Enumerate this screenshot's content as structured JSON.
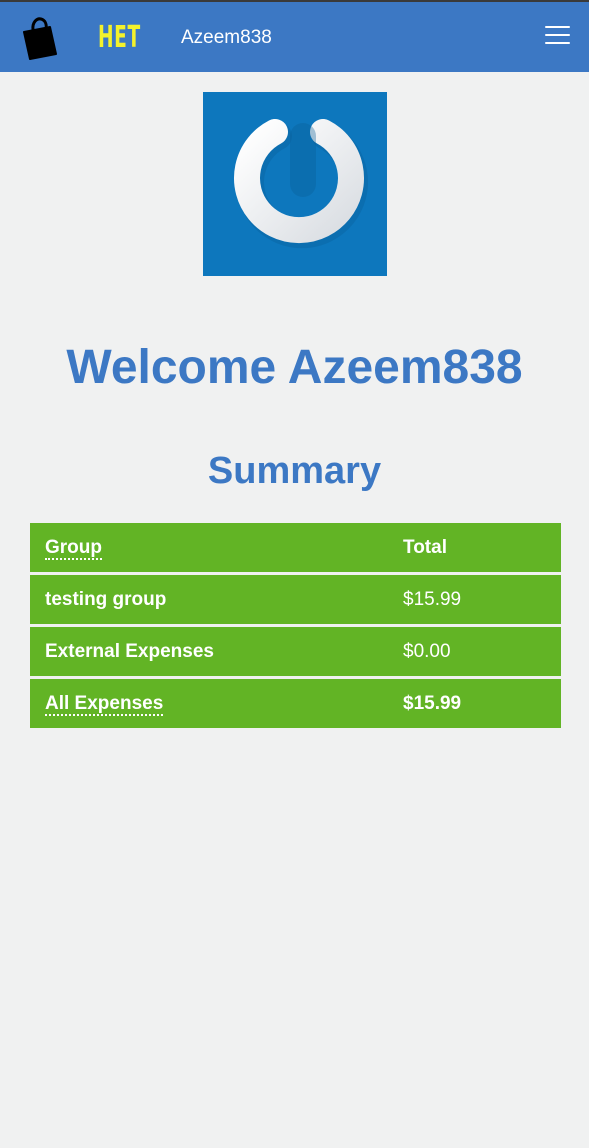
{
  "navbar": {
    "brand": "HET",
    "username": "Azeem838",
    "brand_color": "#f3f22c",
    "background": "#3c78c4"
  },
  "icons": {
    "bag": "shopping-bag-icon",
    "menu": "hamburger-menu-icon",
    "logo": "power-logo"
  },
  "main": {
    "welcome": "Welcome Azeem838",
    "summary_title": "Summary"
  },
  "table": {
    "header": {
      "group": "Group",
      "total": "Total"
    },
    "rows": [
      {
        "group": "testing group",
        "total": "$15.99"
      },
      {
        "group": "External Expenses",
        "total": "$0.00"
      }
    ],
    "footer": {
      "group": "All Expenses",
      "total": "$15.99"
    },
    "row_color": "#62b425"
  }
}
